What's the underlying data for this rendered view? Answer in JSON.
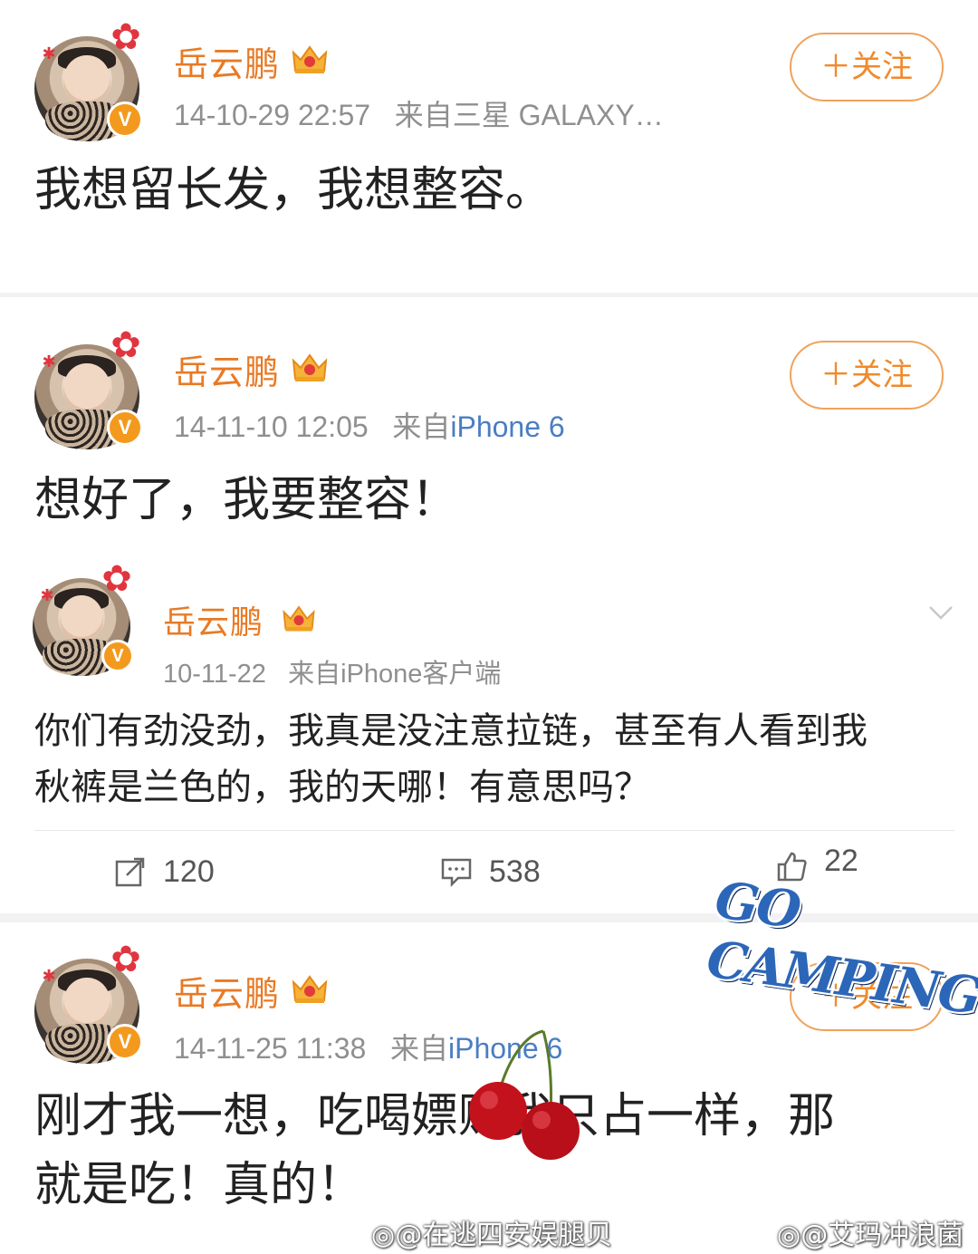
{
  "posts": [
    {
      "username": "岳云鹏",
      "time": "14-10-29 22:57",
      "source_prefix": "来自",
      "source": "三星 GALAXY…",
      "follow_label": "＋关注",
      "content": "我想留长发，我想整容。"
    },
    {
      "username": "岳云鹏",
      "time": "14-11-10 12:05",
      "source_prefix": "来自",
      "source": "iPhone 6",
      "follow_label": "＋关注",
      "content": "想好了，我要整容！"
    },
    {
      "username": "岳云鹏",
      "time": "10-11-22",
      "source_prefix": "来自",
      "source": "iPhone客户端",
      "content_line1": "你们有劲没劲，我真是没注意拉链，甚至有人看到我",
      "content_line2": "秋裤是兰色的，我的天哪！有意思吗？",
      "actions": {
        "repost_count": "120",
        "comment_count": "538",
        "like_count": "22"
      }
    },
    {
      "username": "岳云鹏",
      "time": "14-11-25 11:38",
      "source_prefix": "来自",
      "source": "iPhone 6",
      "follow_label": "＋关注",
      "content_line1": "刚才我一想，吃喝嫖赌我只占一样，那",
      "content_line2": "就是吃！真的！"
    }
  ],
  "stickers": {
    "camping_text": "GO CAMPING"
  },
  "watermarks": {
    "left": "@在逃四安娱腿贝",
    "right": "@艾玛冲浪菌"
  },
  "colors": {
    "username": "#e87a24",
    "follow": "#f08a2b",
    "link": "#4a7ec2",
    "verified_badge": "#f39a1e"
  },
  "icons": [
    "flower-icon",
    "crown-icon",
    "verified-icon",
    "chevron-down-icon",
    "repost-icon",
    "comment-icon",
    "like-icon",
    "cherry-icon",
    "weibo-icon"
  ]
}
